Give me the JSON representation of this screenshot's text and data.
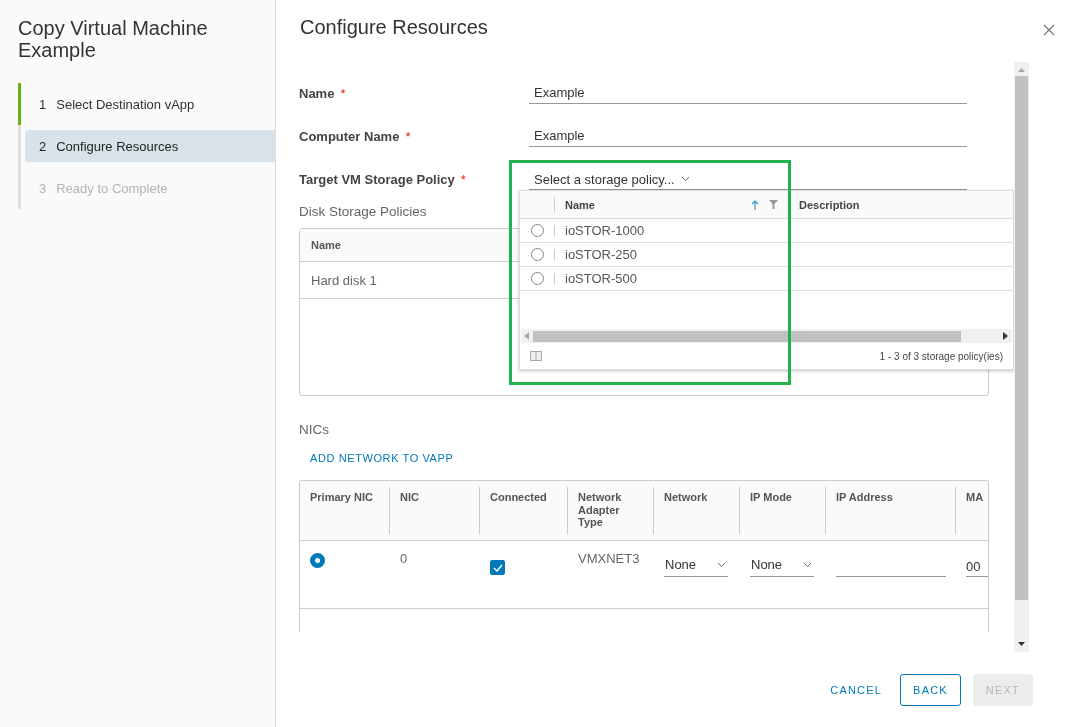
{
  "wizard": {
    "title": "Copy Virtual Machine Example",
    "steps": [
      {
        "number": "1",
        "label": "Select Destination vApp",
        "completed": true,
        "selected": false,
        "disabled": false
      },
      {
        "number": "2",
        "label": "Configure Resources",
        "completed": false,
        "selected": true,
        "disabled": false
      },
      {
        "number": "3",
        "label": "Ready to Complete",
        "completed": false,
        "selected": false,
        "disabled": true
      }
    ]
  },
  "dialog": {
    "title": "Configure Resources"
  },
  "fields": [
    {
      "label": "Name",
      "required_mark": "*",
      "kind": "text",
      "value": "Example"
    },
    {
      "label": "Computer Name",
      "required_mark": "*",
      "kind": "text",
      "value": "Example"
    },
    {
      "label": "Target VM Storage Policy",
      "required_mark": "*",
      "kind": "select",
      "value": "Select a storage policy..."
    }
  ],
  "storage_dropdown": {
    "columns": [
      "Name",
      "Description"
    ],
    "rows": [
      {
        "name": "ioSTOR-1000",
        "selected": false
      },
      {
        "name": "ioSTOR-250",
        "selected": false
      },
      {
        "name": "ioSTOR-500",
        "selected": false
      }
    ],
    "footer": "1 - 3 of 3 storage policy(ies)"
  },
  "disk_storage": {
    "heading": "Disk Storage Policies",
    "columns": [
      "Name"
    ],
    "rows": [
      [
        "Hard disk 1"
      ]
    ]
  },
  "nics": {
    "heading": "NICs",
    "add_link": "ADD NETWORK TO VAPP",
    "columns": [
      "Primary NIC",
      "NIC",
      "Connected",
      "Network Adapter Type",
      "Network",
      "IP Mode",
      "IP Address",
      "MA"
    ],
    "rows": [
      {
        "selected": true,
        "nic": "0",
        "connected": true,
        "adapter_type": "VMXNET3",
        "network": "None",
        "ip_mode": "None",
        "mac": "00"
      }
    ]
  },
  "buttons": [
    {
      "label": "CANCEL",
      "kind": "flat",
      "disabled": false
    },
    {
      "label": "BACK",
      "kind": "outline",
      "disabled": false
    },
    {
      "label": "NEXT",
      "kind": "solid",
      "disabled": true
    }
  ]
}
